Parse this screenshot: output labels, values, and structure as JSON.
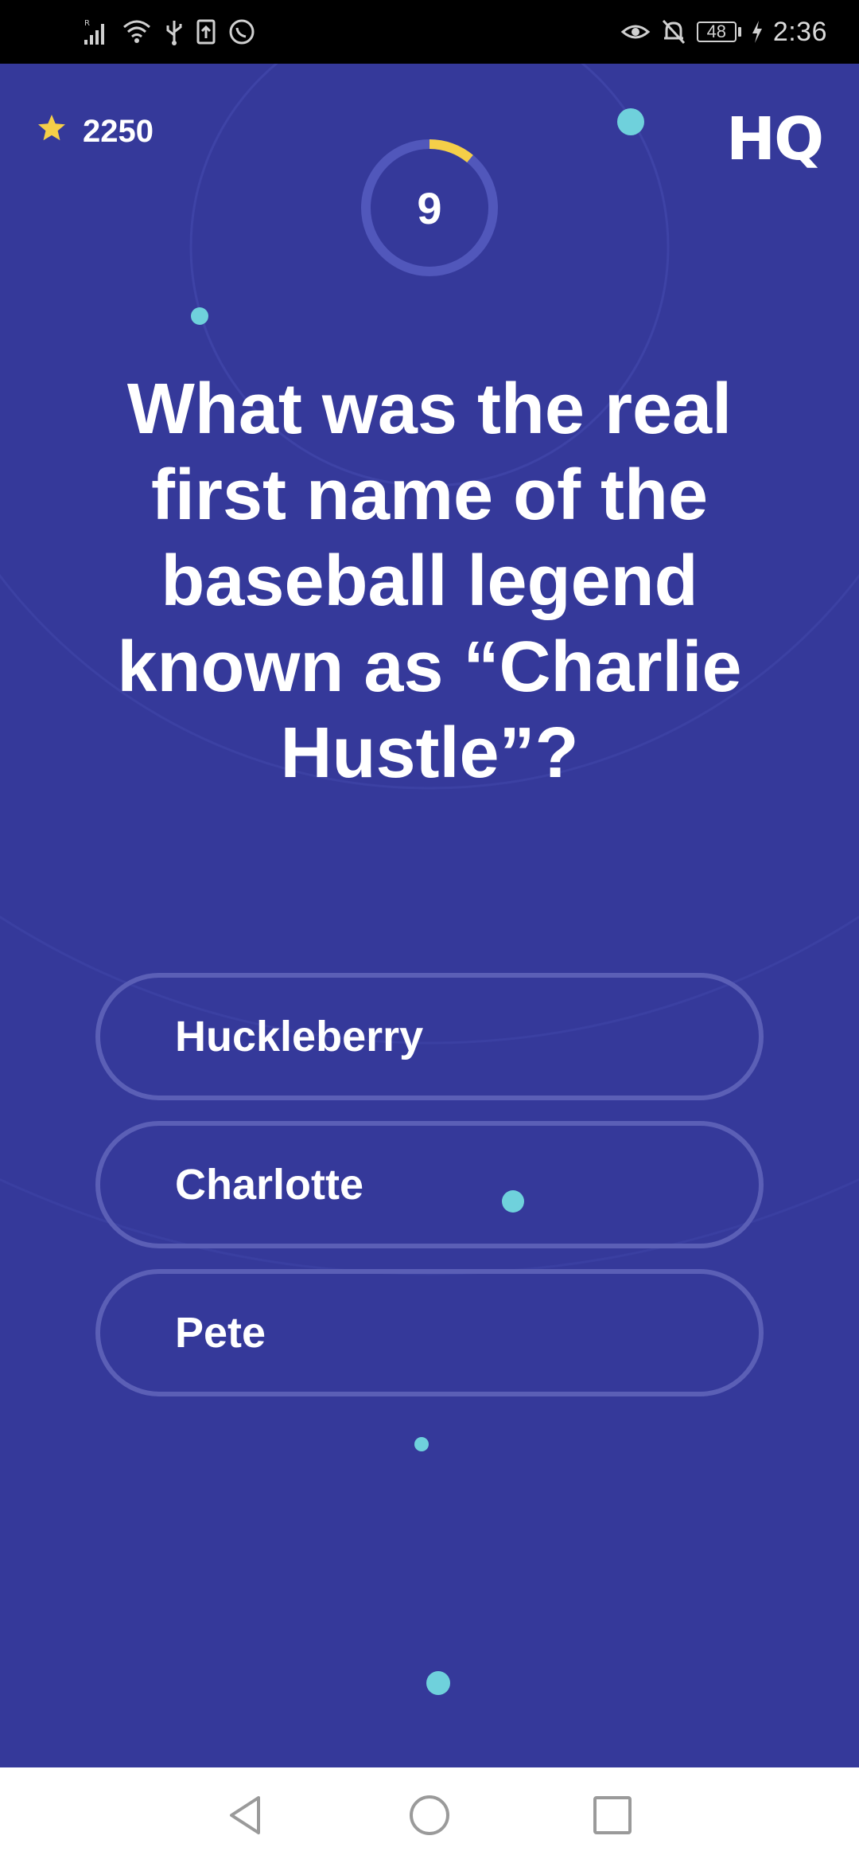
{
  "status_bar": {
    "time": "2:36",
    "battery_level": "48",
    "signal_badge": "R",
    "icons_left": [
      "signal-icon",
      "wifi-icon",
      "usb-icon",
      "upload-icon",
      "whatsapp-icon"
    ],
    "icons_right": [
      "eye-icon",
      "notifications-off-icon",
      "battery-icon",
      "charging-icon"
    ]
  },
  "game": {
    "score": "2250",
    "logo": "HQ",
    "timer_value": "9",
    "timer_progress": 0.11,
    "colors": {
      "background": "#35399a",
      "accent": "#f5cf48",
      "dot": "#6fd1dc",
      "answer_border": "#5b5fb6"
    },
    "question": "What was the real first name of the baseball legend known as “Charlie Hustle”?",
    "answers": [
      {
        "label": "Huckleberry"
      },
      {
        "label": "Charlotte"
      },
      {
        "label": "Pete"
      }
    ]
  },
  "nav_bar": {
    "buttons": [
      "back-icon",
      "home-icon",
      "recents-icon"
    ]
  }
}
